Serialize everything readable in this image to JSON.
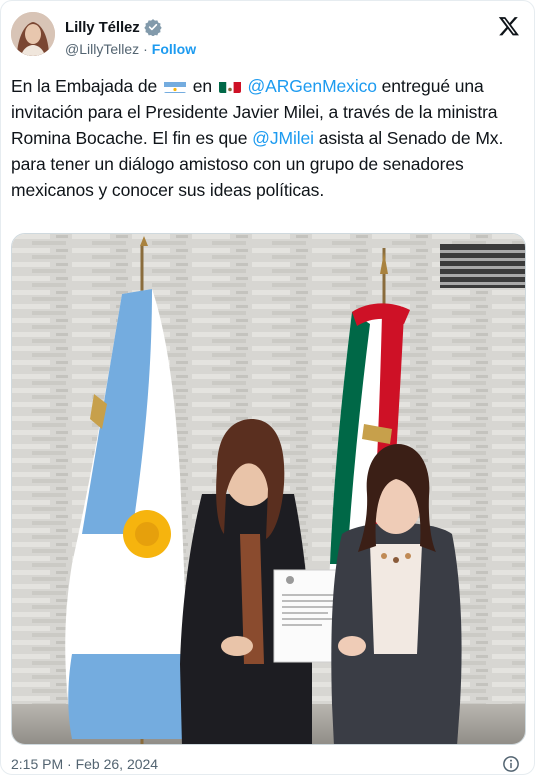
{
  "author": {
    "display_name": "Lilly Téllez",
    "handle": "@LillyTellez",
    "follow_label": "Follow",
    "verified_icon": "verified-badge-icon",
    "avatar_icon": "profile-avatar"
  },
  "header": {
    "logo_icon": "x-logo-icon"
  },
  "tweet": {
    "text_1": "En la Embajada de",
    "flag_1": "argentina-flag-emoji",
    "text_2": "en",
    "flag_2": "mexico-flag-emoji",
    "mention_1": "@ARGenMexico",
    "text_3": "entregué una invitación para el Presidente Javier Milei, a través de la ministra Romina Bocache. El fin es que",
    "mention_2": "@JMilei",
    "text_4": "asista al Senado de Mx. para tener un diálogo amistoso con un grupo de senadores mexicanos y conocer sus ideas políticas."
  },
  "media": {
    "description_icon": "embassy-photo"
  },
  "footer": {
    "timestamp": "2:15 PM · Feb 26, 2024",
    "info_icon": "info-icon"
  },
  "colors": {
    "link": "#1d9bf0",
    "text": "#0f1419",
    "muted": "#536471"
  }
}
